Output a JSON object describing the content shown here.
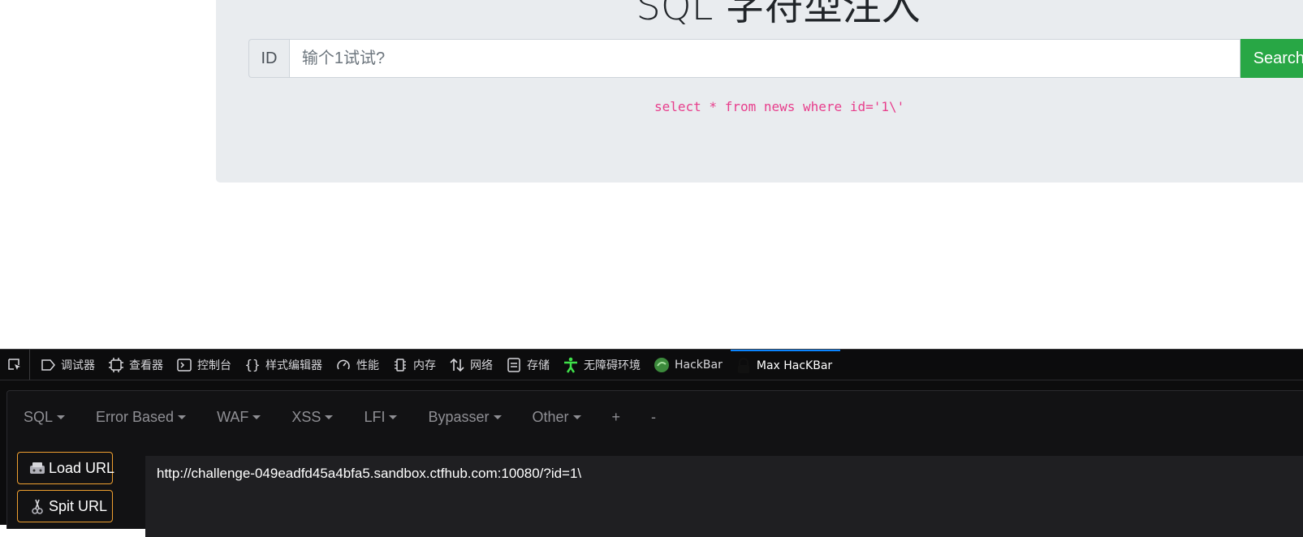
{
  "page": {
    "title": "SQL 字符型注入",
    "input_prefix": "ID",
    "input_placeholder": "输个1试试?",
    "search_label": "Search",
    "sql_query": "select * from news where id='1\\'",
    "colors": {
      "jumbotron_bg": "#e9ecef",
      "search_btn": "#28a745",
      "query_text": "#e83e8c"
    }
  },
  "devtools": {
    "tabs": [
      {
        "label": "调试器",
        "icon": "debugger-icon"
      },
      {
        "label": "查看器",
        "icon": "inspector-icon"
      },
      {
        "label": "控制台",
        "icon": "console-icon"
      },
      {
        "label": "样式编辑器",
        "icon": "style-editor-icon"
      },
      {
        "label": "性能",
        "icon": "performance-icon"
      },
      {
        "label": "内存",
        "icon": "memory-icon"
      },
      {
        "label": "网络",
        "icon": "network-icon"
      },
      {
        "label": "存储",
        "icon": "storage-icon"
      },
      {
        "label": "无障碍环境",
        "icon": "accessibility-icon"
      },
      {
        "label": "HackBar",
        "icon": "hackbar-icon"
      },
      {
        "label": "Max HacKBar",
        "icon": "max-hackbar-icon",
        "active": true
      }
    ],
    "active_color": "#0a84ff"
  },
  "hackbar": {
    "menu": [
      "SQL",
      "Error Based",
      "WAF",
      "XSS",
      "LFI",
      "Bypasser",
      "Other",
      "+",
      "-"
    ],
    "load_url_label": "Load URL",
    "split_url_label": "Spit URL",
    "url_value": "http://challenge-049eadfd45a4bfa5.sandbox.ctfhub.com:10080/?id=1\\",
    "button_border_color": "#f0a030"
  }
}
